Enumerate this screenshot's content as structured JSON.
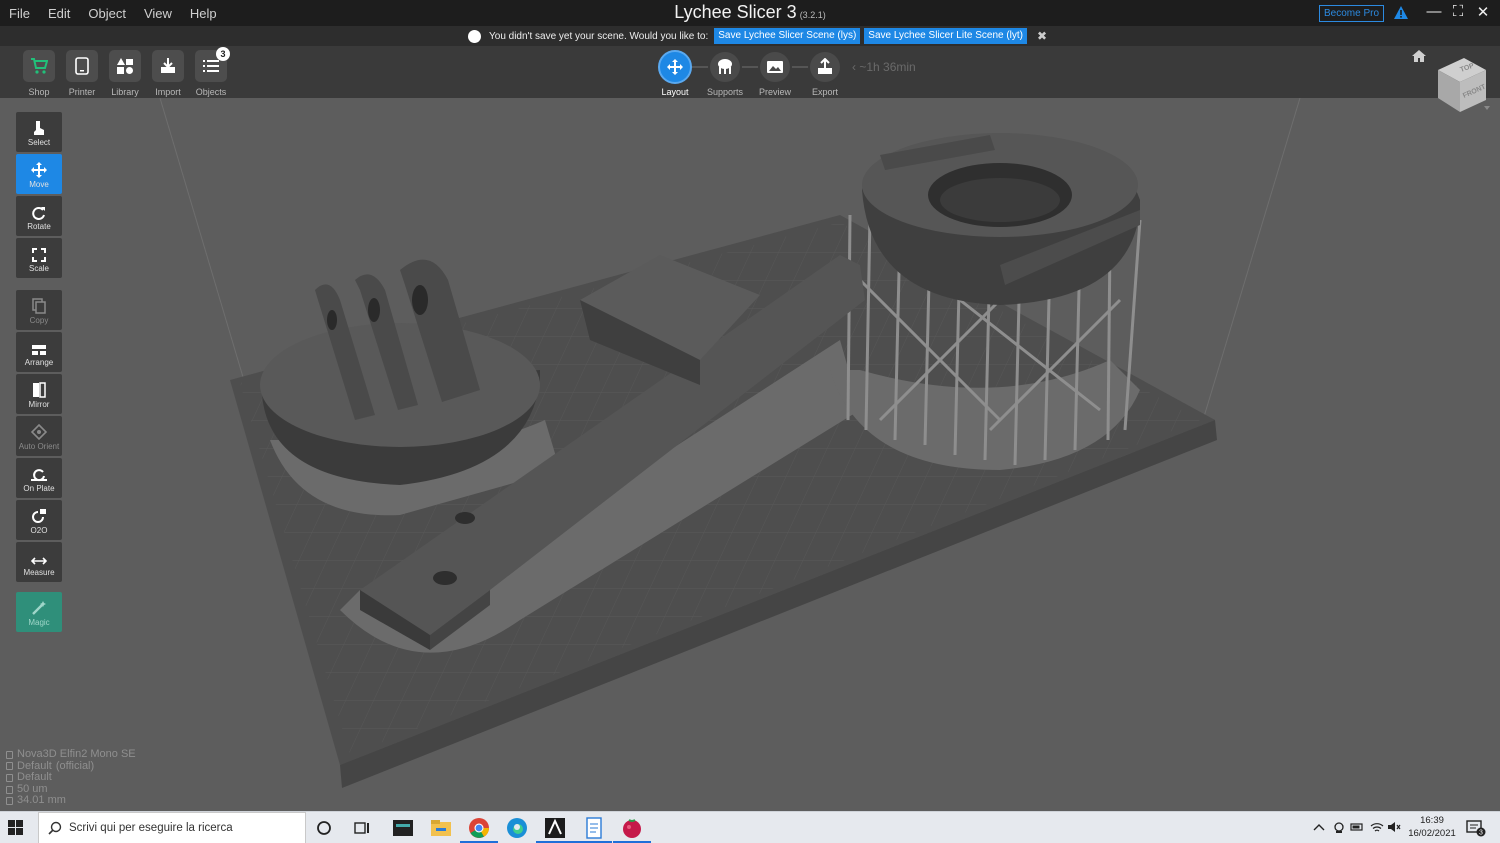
{
  "app": {
    "menu": [
      "File",
      "Edit",
      "Object",
      "View",
      "Help"
    ],
    "title": "Lychee Slicer 3",
    "version": "(3.2.1)",
    "become_pro": "Become Pro"
  },
  "notification": {
    "text": "You didn't save yet your scene. Would you like to:",
    "save_lys": "Save Lychee Slicer Scene (lys)",
    "save_lyt": "Save Lychee Slicer Lite Scene (lyt)"
  },
  "toolbar": {
    "shop": "Shop",
    "printer": "Printer",
    "library": "Library",
    "import": "Import",
    "objects": "Objects",
    "objects_count": "3",
    "steps": [
      "Layout",
      "Supports",
      "Preview",
      "Export"
    ],
    "active_step": "Layout",
    "eta": "~1h 36min"
  },
  "tools": [
    "Select",
    "Move",
    "Rotate",
    "Scale",
    "Copy",
    "Arrange",
    "Mirror",
    "Auto Orient",
    "On Plate",
    "O2O",
    "Measure",
    "Magic"
  ],
  "active_tool": "Move",
  "info": {
    "printer": "Nova3D Elfin2 Mono SE",
    "profile": "Default",
    "profile_tag": "(official)",
    "resin": "Default",
    "layer": "50 um",
    "height": "34.01 mm"
  },
  "viewcube": {
    "top": "TOP",
    "front": "FRONT"
  },
  "taskbar": {
    "search_placeholder": "Scrivi qui per eseguire la ricerca",
    "time": "16:39",
    "date": "16/02/2021",
    "notifications": "3"
  },
  "colors": {
    "accent": "#1e88e5",
    "magic": "#2f8f7a",
    "viewport": "#5c5c5c"
  }
}
